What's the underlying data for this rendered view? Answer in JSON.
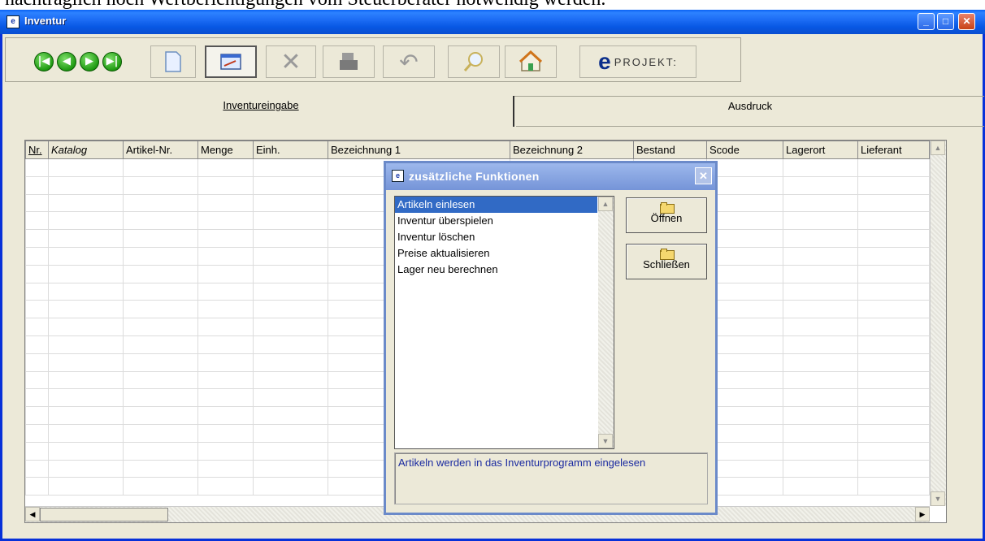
{
  "doc_text": "nachträglich noch Wertberichtigungen vom Steuerberater notwendig werden.",
  "window": {
    "title": "Inventur",
    "controls": {
      "minimize": "_",
      "maximize": "□",
      "close": "✕"
    }
  },
  "toolbar": {
    "buttons": [
      {
        "name": "first-icon",
        "glyph": "◀"
      },
      {
        "name": "new-document-icon"
      },
      {
        "name": "edit-icon"
      },
      {
        "name": "delete-icon",
        "glyph": "✕"
      },
      {
        "name": "print-icon"
      },
      {
        "name": "undo-icon",
        "glyph": "↶"
      },
      {
        "name": "search-icon"
      },
      {
        "name": "home-icon"
      }
    ],
    "logo_letter": "e",
    "logo_text": "PROJEKT:"
  },
  "tabs": [
    {
      "label": "Inventureingabe",
      "active": true
    },
    {
      "label": "Ausdruck",
      "active": false
    }
  ],
  "grid": {
    "columns": [
      "Nr.",
      "Katalog",
      "Artikel-Nr.",
      "Menge",
      "Einh.",
      "Bezeichnung 1",
      "Bezeichnung 2",
      "Bestand",
      "Scode",
      "Lagerort",
      "Lieferant"
    ]
  },
  "dialog": {
    "title": "zusätzliche Funktionen",
    "close": "✕",
    "items": [
      "Artikeln einlesen",
      "Inventur überspielen",
      "Inventur löschen",
      "Preise aktualisieren",
      "Lager neu berechnen"
    ],
    "selected_index": 0,
    "open_label": "Öffnen",
    "close_label": "Schließen",
    "description": "Artikeln werden in das Inventurprogramm eingelesen"
  }
}
